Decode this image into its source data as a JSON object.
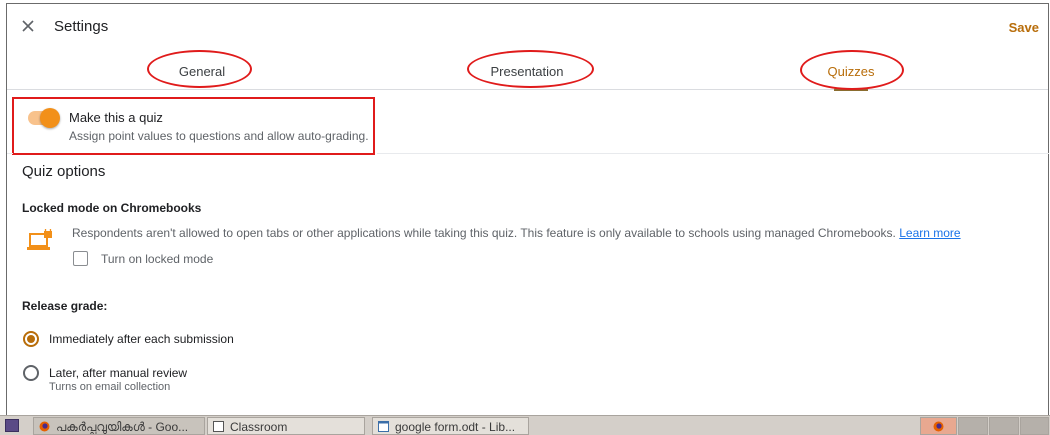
{
  "header": {
    "title": "Settings",
    "save_label": "Save"
  },
  "tabs": [
    {
      "label": "General",
      "active": false
    },
    {
      "label": "Presentation",
      "active": false
    },
    {
      "label": "Quizzes",
      "active": true
    }
  ],
  "quiz_toggle": {
    "title": "Make this a quiz",
    "description": "Assign point values to questions and allow auto-grading.",
    "enabled": true
  },
  "quiz_options": {
    "heading": "Quiz options",
    "locked_mode": {
      "heading": "Locked mode on Chromebooks",
      "description": "Respondents aren't allowed to open tabs or other applications while taking this quiz. This feature is only available to schools using managed Chromebooks.",
      "learn_more": "Learn more",
      "checkbox_label": "Turn on locked mode",
      "checked": false
    },
    "release_grade": {
      "heading": "Release grade:",
      "options": [
        {
          "label": "Immediately after each submission",
          "sub": "",
          "selected": true
        },
        {
          "label": "Later, after manual review",
          "sub": "Turns on email collection",
          "selected": false
        }
      ]
    }
  },
  "taskbar": {
    "items": [
      {
        "label": "പകർപ്പവുയികൾ - Goo...",
        "icon": "firefox-icon"
      },
      {
        "label": "Classroom",
        "icon": "window-icon"
      },
      {
        "label": "google form.odt - Lib...",
        "icon": "document-icon"
      }
    ]
  },
  "colors": {
    "accent": "#b86d0a",
    "toggle_knob": "#f29019",
    "annotation_red": "#e01b1b",
    "link": "#1a73e8"
  }
}
